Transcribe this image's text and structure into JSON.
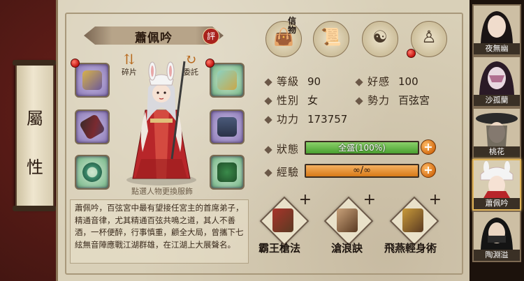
{
  "side_tab": {
    "chars": [
      "屬",
      "性"
    ]
  },
  "character": {
    "name": "蕭佩吟",
    "rating_badge": "評",
    "hint": "點選人物更換服飾",
    "description": "蕭佩吟，百弦宮中最有望接任宮主的首席弟子，精通音律，尤其精通百弦共鳴之道，其人不善酒，一杯便醉，行事慎重，顧全大局，曾攜下七絃無音陣應戰江湖群雄，在江湖上大展聲名。"
  },
  "side_buttons": {
    "fragments": "碎片",
    "entrust": "委託"
  },
  "top_icons": {
    "xinwu_label": "信\n物"
  },
  "stats": {
    "level_label": "等級",
    "level": "90",
    "favor_label": "好感",
    "favor": "100",
    "gender_label": "性別",
    "gender": "女",
    "faction_label": "勢力",
    "faction": "百弦宮",
    "power_label": "功力",
    "power": "173757"
  },
  "bars": {
    "status_label": "狀態",
    "status_text": "全盛(100%)",
    "status_fraction": 1.0,
    "status_color": "#4aa030",
    "exp_label": "經驗",
    "exp_text": "∞/∞",
    "exp_fraction": 1.0,
    "exp_color": "#d87a18"
  },
  "skills": [
    {
      "name": "霸王槍法",
      "plus": "+",
      "color": "#a8342a"
    },
    {
      "name": "滄浪訣",
      "plus": "+",
      "color": "#c9a27a"
    },
    {
      "name": "飛燕輕身術",
      "plus": "+",
      "color": "#c99a3a"
    }
  ],
  "roster": [
    {
      "name": "夜無幽"
    },
    {
      "name": "沙孤蘭"
    },
    {
      "name": "桃花"
    },
    {
      "name": "蕭佩吟"
    },
    {
      "name": "陶淵溢"
    }
  ]
}
